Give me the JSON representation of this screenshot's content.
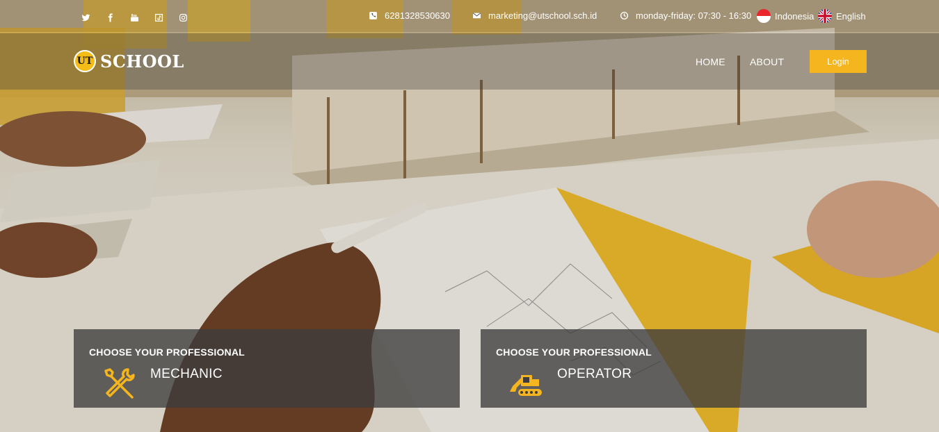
{
  "topbar": {
    "socials": [
      {
        "name": "twitter",
        "icon": "twitter-icon"
      },
      {
        "name": "facebook",
        "icon": "facebook-icon"
      },
      {
        "name": "youtube",
        "icon": "youtube-icon"
      },
      {
        "name": "tiktok",
        "icon": "tiktok-icon"
      },
      {
        "name": "instagram",
        "icon": "instagram-icon"
      }
    ],
    "phone": "6281328530630",
    "email": "marketing@utschool.sch.id",
    "hours": "monday-friday: 07:30 - 16:30",
    "languages": [
      {
        "label": "Indonesia",
        "icon": "indonesia-flag-icon"
      },
      {
        "label": "English",
        "icon": "uk-flag-icon"
      }
    ]
  },
  "navbar": {
    "logo_mark": "UT",
    "logo_text": "SCHOOL",
    "links": [
      "HOME",
      "ABOUT"
    ],
    "login_label": "Login"
  },
  "cards": [
    {
      "eyebrow": "CHOOSE YOUR PROFESSIONAL",
      "title": "MECHANIC",
      "icon": "tools-icon"
    },
    {
      "eyebrow": "CHOOSE YOUR PROFESSIONAL",
      "title": "OPERATOR",
      "icon": "excavator-icon"
    }
  ],
  "colors": {
    "accent": "#f5b51e",
    "card_bg": "#3c3c3c",
    "text": "#ffffff"
  }
}
